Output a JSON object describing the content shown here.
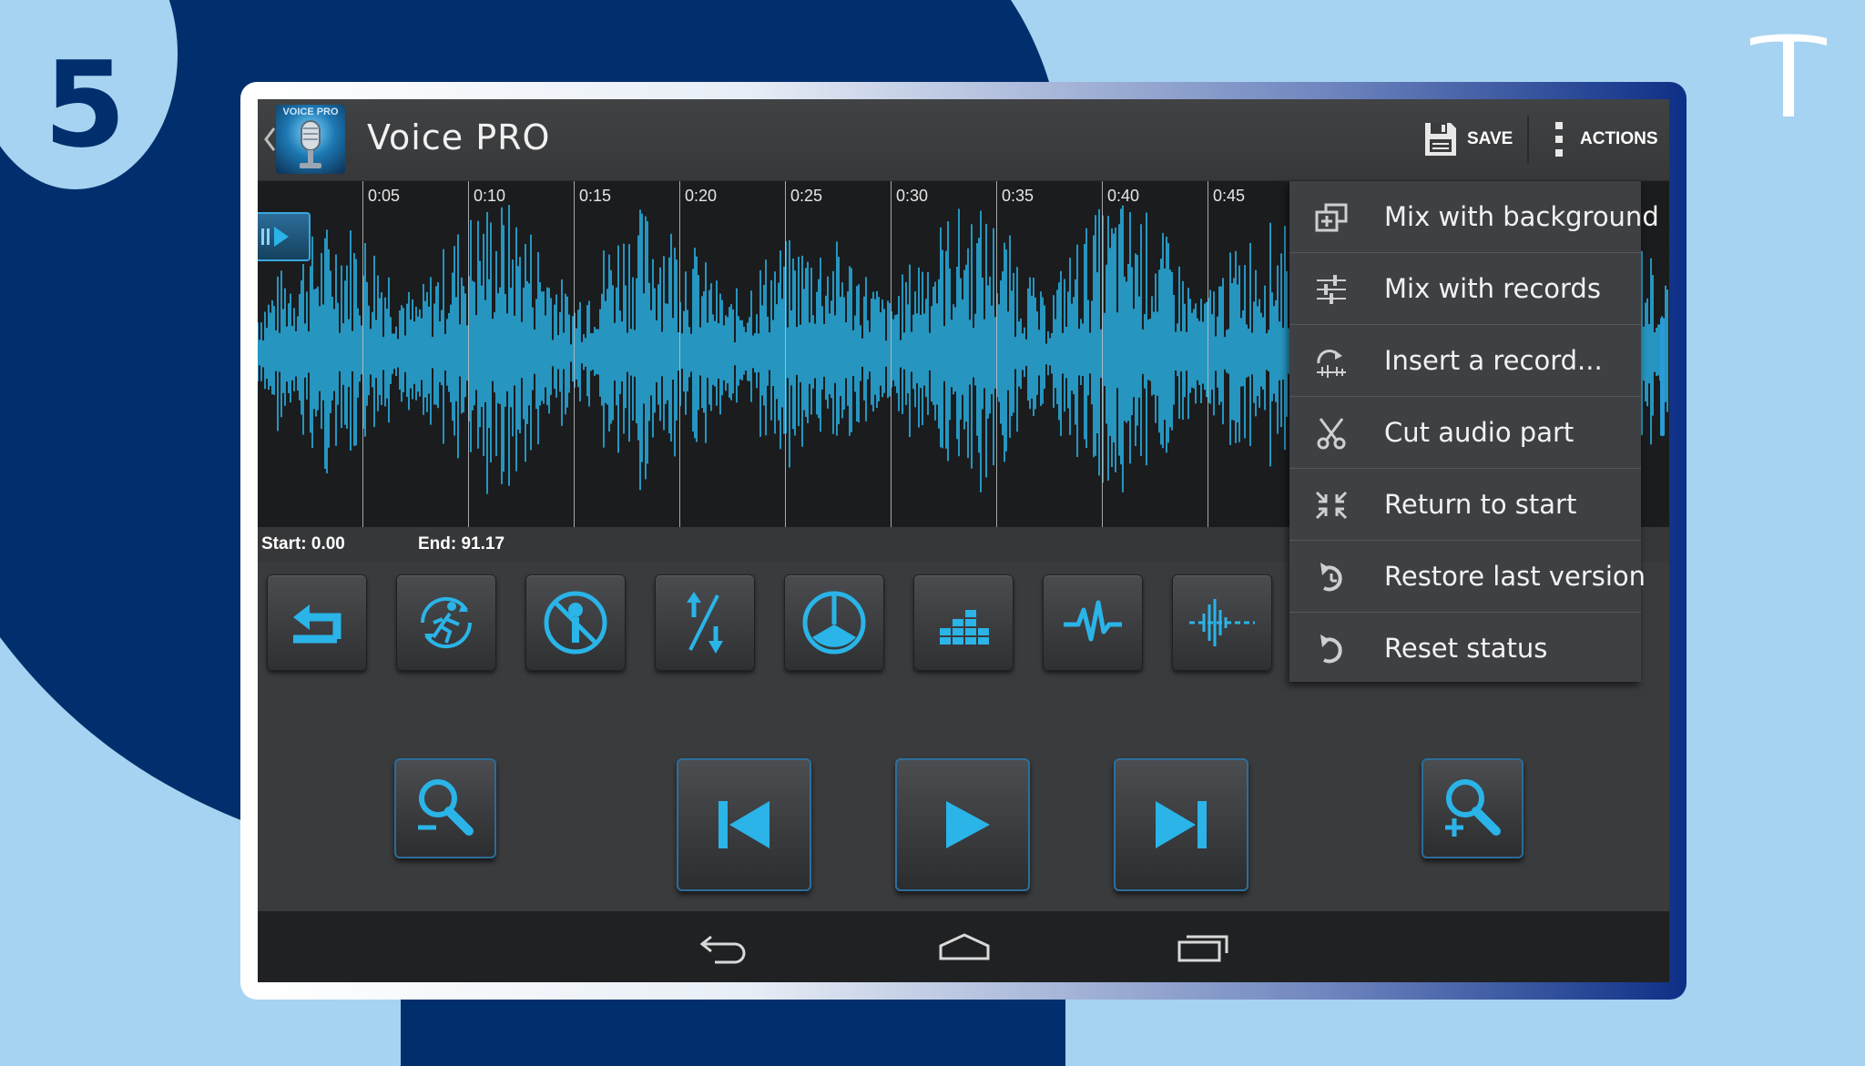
{
  "step": {
    "number": "5"
  },
  "app": {
    "title": "Voice PRO",
    "logo_text": "VOICE PRO"
  },
  "actionbar": {
    "save_label": "SAVE",
    "actions_label": "ACTIONS"
  },
  "timeline": {
    "ticks": [
      "0:05",
      "0:10",
      "0:15",
      "0:20",
      "0:25",
      "0:30",
      "0:35",
      "0:40",
      "0:45"
    ]
  },
  "status": {
    "start": "Start: 0.00",
    "end": "End: 91.17"
  },
  "tools": [
    {
      "name": "undo",
      "icon": "undo-icon"
    },
    {
      "name": "tempo",
      "icon": "running-man-icon"
    },
    {
      "name": "vocal-remove",
      "icon": "mic-off-icon"
    },
    {
      "name": "pitch",
      "icon": "pitch-arrows-icon"
    },
    {
      "name": "effects",
      "icon": "peace-icon"
    },
    {
      "name": "equalizer",
      "icon": "equalizer-icon"
    },
    {
      "name": "waveform",
      "icon": "waveform-icon"
    },
    {
      "name": "noise",
      "icon": "noise-icon"
    }
  ],
  "transport": [
    {
      "name": "zoom-out",
      "icon": "zoom-out-icon"
    },
    {
      "name": "previous",
      "icon": "skip-previous-icon"
    },
    {
      "name": "play",
      "icon": "play-icon"
    },
    {
      "name": "next",
      "icon": "skip-next-icon"
    },
    {
      "name": "zoom-in",
      "icon": "zoom-in-icon"
    }
  ],
  "menu": {
    "items": [
      {
        "label": "Mix with background",
        "icon": "mix-background-icon"
      },
      {
        "label": "Mix with records",
        "icon": "sliders-icon"
      },
      {
        "label": "Insert a record...",
        "icon": "insert-record-icon"
      },
      {
        "label": "Cut audio part",
        "icon": "scissors-icon"
      },
      {
        "label": "Return to start",
        "icon": "compress-icon"
      },
      {
        "label": "Restore last version",
        "icon": "restore-icon"
      },
      {
        "label": "Reset status",
        "icon": "reset-icon"
      }
    ]
  },
  "colors": {
    "accent": "#2ab4e8",
    "page_bg": "#a6d3f1",
    "navy": "#012f6d",
    "screen_bg": "#3a3b3d"
  }
}
